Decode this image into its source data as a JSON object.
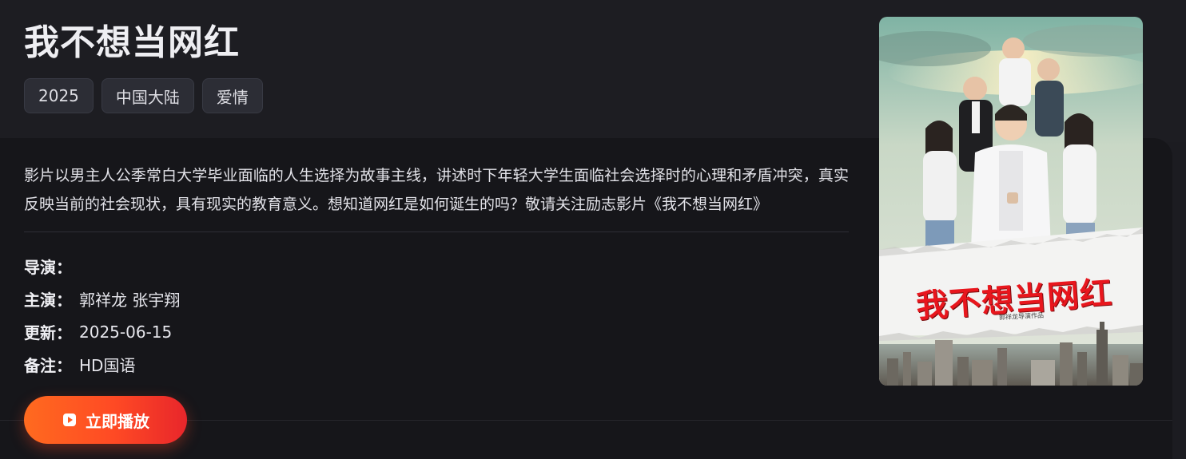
{
  "movie": {
    "title": "我不想当网红",
    "tags": [
      "2025",
      "中国大陆",
      "爱情"
    ],
    "description": "影片以男主人公季常白大学毕业面临的人生选择为故事主线，讲述时下年轻大学生面临社会选择时的心理和矛盾冲突，真实反映当前的社会现状，具有现实的教育意义。想知道网红是如何诞生的吗？敬请关注励志影片《我不想当网红》",
    "info": [
      {
        "key": "导演：",
        "value": ""
      },
      {
        "key": "主演：",
        "value": "郭祥龙 张宇翔"
      },
      {
        "key": "更新：",
        "value": "2025-06-15"
      },
      {
        "key": "备注：",
        "value": "HD国语"
      }
    ],
    "play_label": "立即播放",
    "poster": {
      "title": "我不想当网红",
      "credit": "郭祥龙导演作品"
    }
  },
  "colors": {
    "background": "#1c1c21",
    "panel": "#16161a",
    "accent_start": "#ff6a1f",
    "accent_end": "#e8262b",
    "poster_title": "#e8161d"
  },
  "icons": {
    "play": "play-icon"
  }
}
